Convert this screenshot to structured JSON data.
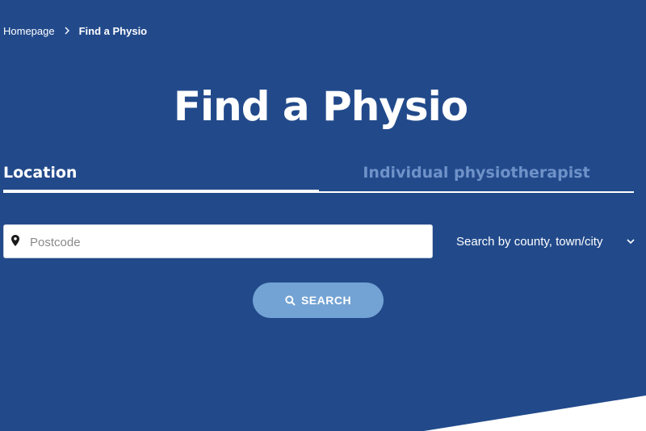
{
  "breadcrumb": {
    "home": "Homepage",
    "current": "Find a Physio"
  },
  "page": {
    "title": "Find a Physio"
  },
  "tabs": [
    {
      "label": "Location",
      "active": true
    },
    {
      "label": "Individual physiotherapist",
      "active": false
    }
  ],
  "search": {
    "postcode_placeholder": "Postcode",
    "postcode_value": "",
    "region_select_label": "Search by county, town/city",
    "button_label": "SEARCH"
  },
  "icons": {
    "breadcrumb_separator": "chevron-right-icon",
    "postcode": "map-pin-icon",
    "region_dropdown": "chevron-down-icon",
    "search_button": "search-icon"
  },
  "colors": {
    "background": "#224a8b",
    "button": "#73a3d4",
    "inactive_tab": "#6f92c9",
    "text": "#ffffff"
  }
}
